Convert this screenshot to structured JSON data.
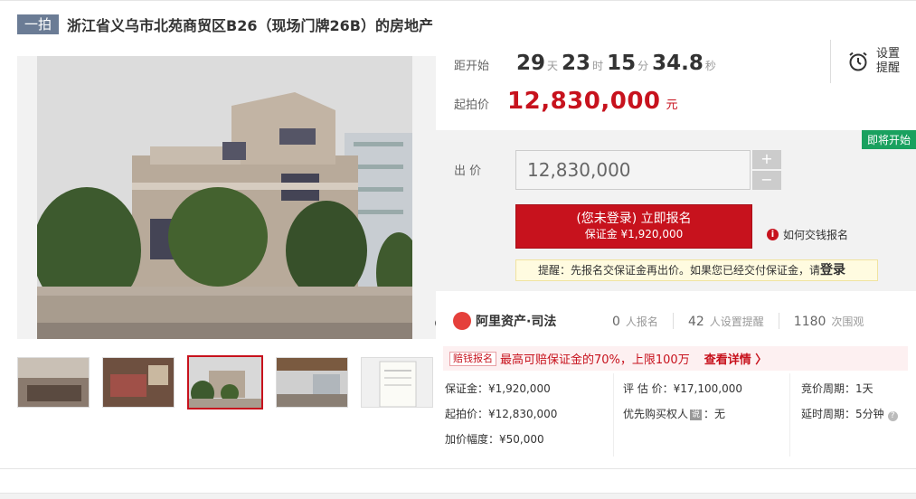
{
  "header": {
    "badge": "一拍",
    "title": "浙江省义乌市北苑商贸区B26（现场门牌26B）的房地产"
  },
  "gallery": {
    "main_image": "villa-photo",
    "thumbnails": [
      "hall-interior-photo",
      "bedroom-photo",
      "villa-exterior-photo",
      "balcony-view-photo",
      "document-photo"
    ],
    "active_index": 2
  },
  "countdown": {
    "label": "距开始",
    "days": "29",
    "days_unit": "天",
    "hours": "23",
    "hours_unit": "时",
    "minutes": "15",
    "minutes_unit": "分",
    "seconds": "34.8",
    "seconds_unit": "秒"
  },
  "reminder": {
    "line1": "设置",
    "line2": "提醒",
    "icon": "alarm-clock-icon"
  },
  "start_price": {
    "label": "起拍价",
    "value": "12,830,000",
    "unit": "元"
  },
  "bid": {
    "status_tag": "即将开始",
    "label": "出 价",
    "input_value": "12,830,000",
    "plus": "+",
    "minus": "−",
    "signup_main": "(您未登录) 立即报名",
    "signup_sub": "保证金 ¥1,920,000",
    "howto": "如何交钱报名",
    "tip_text": "提醒：先报名交保证金再出价。如果您已经交付保证金，请",
    "tip_link": "登录"
  },
  "stats": {
    "brand": "阿里资产·司法",
    "signups": "0",
    "signups_label": "人报名",
    "reminders": "42",
    "reminders_label": "人设置提醒",
    "views": "1180",
    "views_label": "次围观"
  },
  "promo": {
    "tag": "赔钱报名",
    "text": "最高可赔保证金的70%，上限100万",
    "link": "查看详情 〉"
  },
  "details": {
    "deposit": "保证金：¥1,920,000",
    "start_price": "起拍价：¥12,830,000",
    "increment": "加价幅度：¥50,000",
    "appraisal": "评 估 价：¥17,100,000",
    "priority_label": "优先购买权人",
    "priority_tag": "说",
    "priority_value": "：无",
    "cycle": "竞价周期：1天",
    "delay": "延时周期：5分钟"
  },
  "colors": {
    "accent": "#c7121d",
    "green": "#19a15f",
    "badge": "#6b7c95"
  }
}
